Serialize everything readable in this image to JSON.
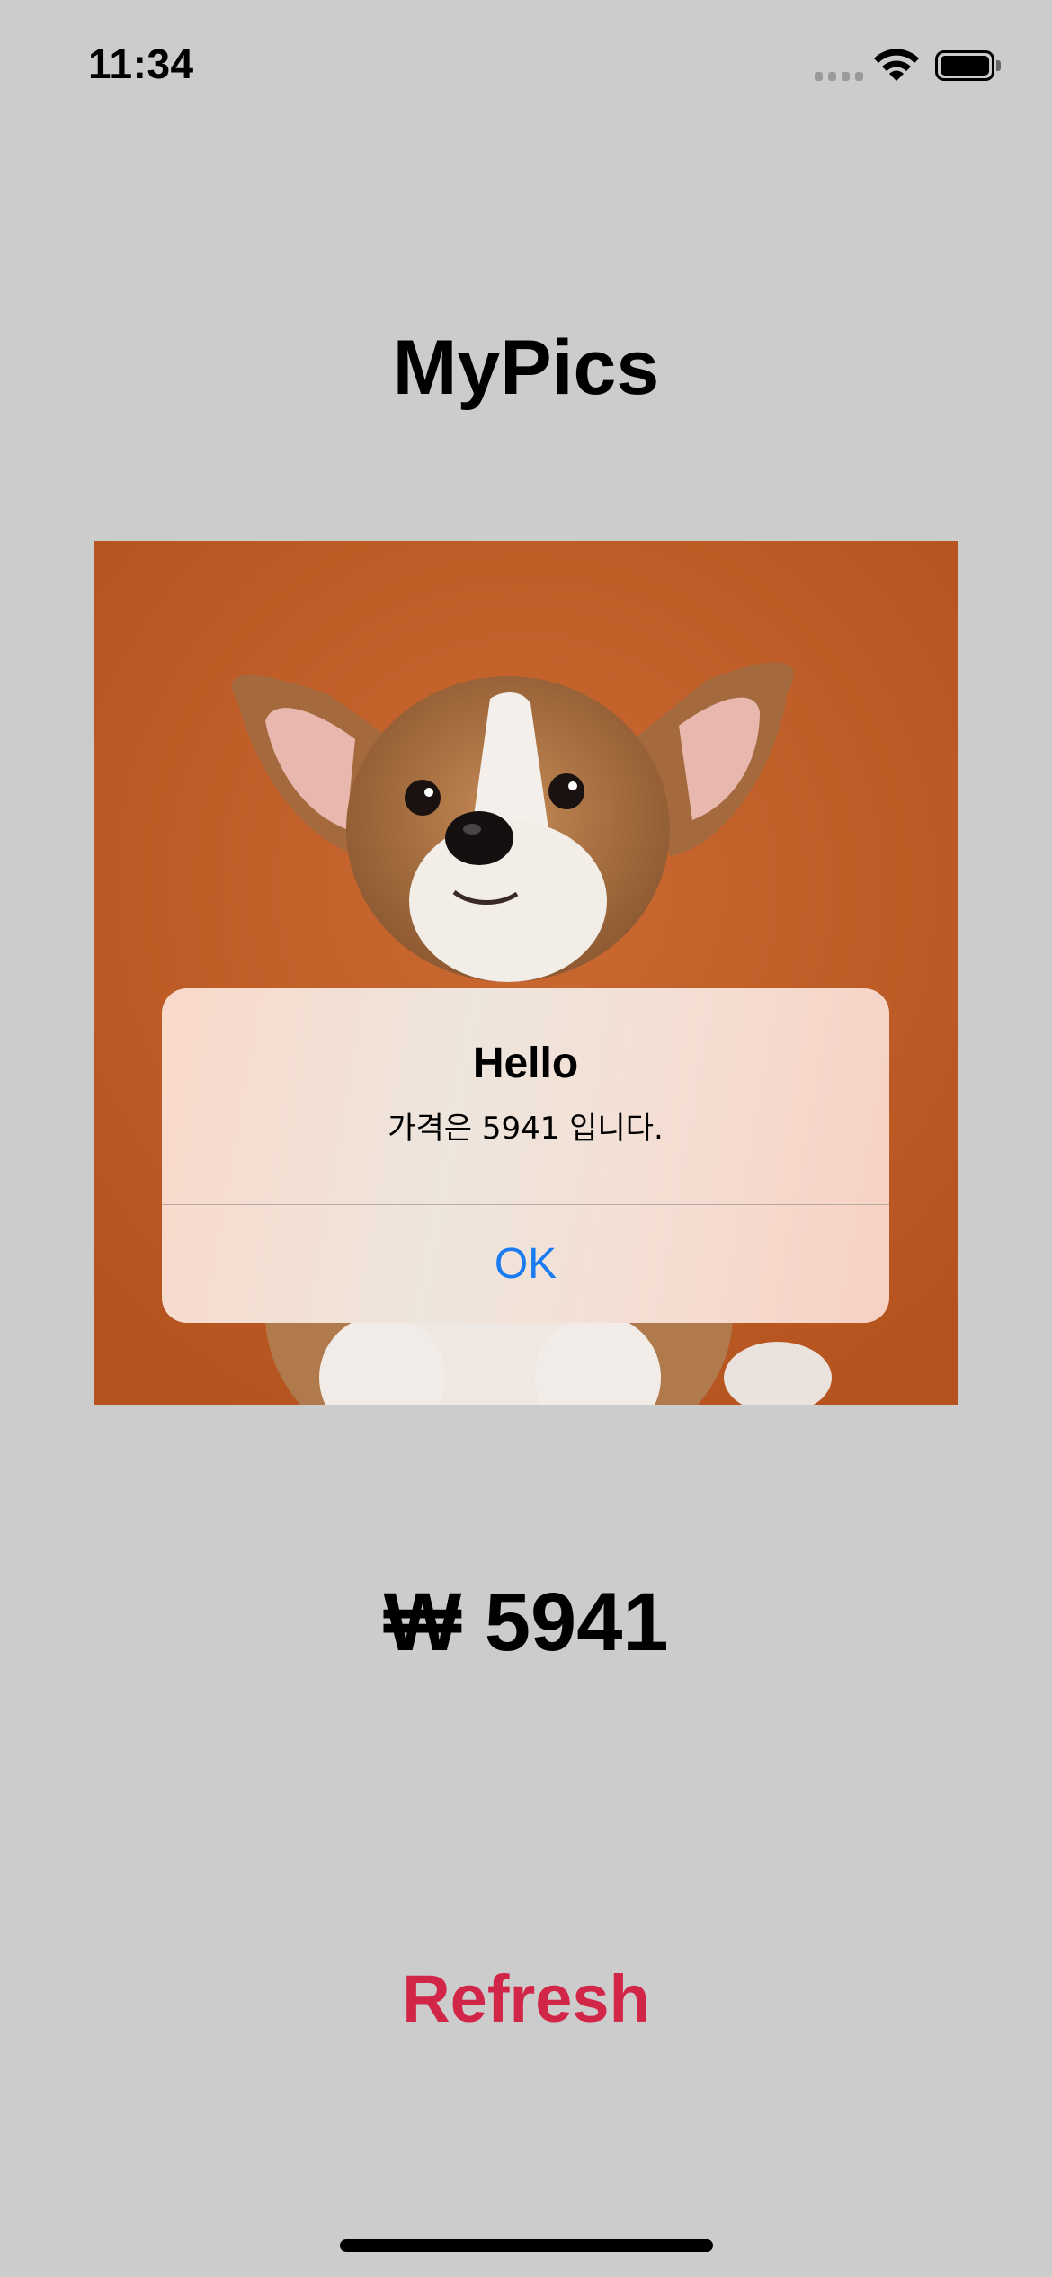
{
  "status_bar": {
    "time": "11:34",
    "icons": [
      "signal-icon",
      "wifi-icon",
      "battery-icon"
    ]
  },
  "app": {
    "title": "MyPics",
    "price": "₩ 5941",
    "refresh_label": "Refresh"
  },
  "photo": {
    "subject": "corgi puppy on orange background"
  },
  "alert": {
    "title": "Hello",
    "message": "가격은 5941 입니다.",
    "ok_label": "OK"
  },
  "colors": {
    "background": "#cccccc",
    "refresh": "#d22648",
    "alert_button": "#1a7cf0",
    "photo_background": "#c35f2a"
  }
}
